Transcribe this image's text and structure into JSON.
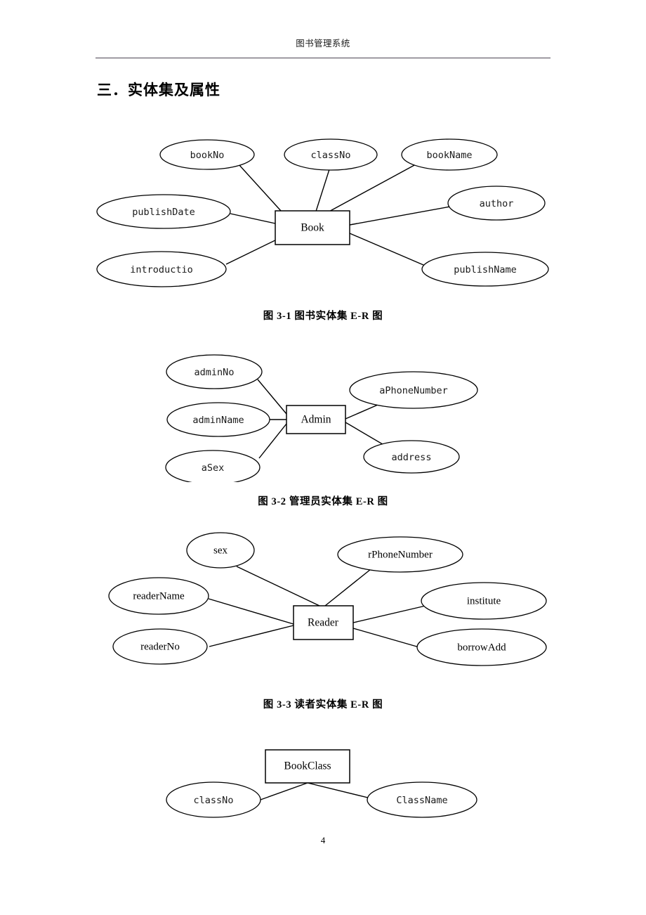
{
  "document": {
    "header_title": "图书管理系统",
    "page_number": "4",
    "section_heading": "三．实体集及属性"
  },
  "figures": [
    {
      "id": "book",
      "caption": "图 3-1 图书实体集 E-R 图",
      "entity": "Book",
      "attributes": [
        "bookNo",
        "classNo",
        "bookName",
        "publishDate",
        "author",
        "introductio",
        "publishName"
      ]
    },
    {
      "id": "admin",
      "caption": "图 3-2 管理员实体集 E-R 图",
      "entity": "Admin",
      "attributes": [
        "adminNo",
        "adminName",
        "aSex",
        "aPhoneNumber",
        "address"
      ]
    },
    {
      "id": "reader",
      "caption": "图 3-3 读者实体集 E-R 图",
      "entity": "Reader",
      "attributes": [
        "sex",
        "rPhoneNumber",
        "readerName",
        "readerNo",
        "institute",
        "borrowAdd"
      ]
    },
    {
      "id": "bookclass",
      "caption": "",
      "entity": "BookClass",
      "attributes": [
        "classNo",
        "ClassName"
      ]
    }
  ],
  "colors": {
    "text": "#000000",
    "rule": "#4b4452",
    "shape_stroke": "#000000",
    "shape_fill": "#ffffff"
  }
}
